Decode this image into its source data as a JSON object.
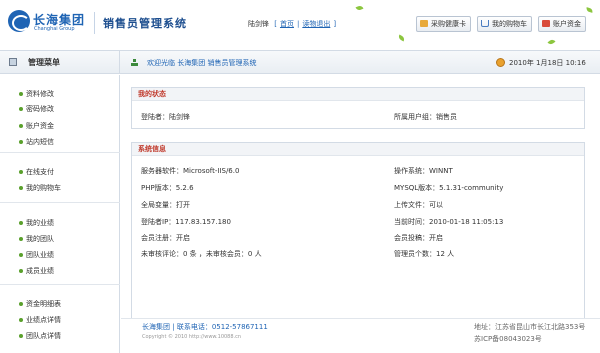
{
  "header": {
    "logo_cn": "长海集团",
    "logo_en": "Changhai Group",
    "system_title": "销售员管理系统",
    "user_name": "陆剑锋",
    "home_link": "首页",
    "logout_link": "读物退出",
    "buttons": [
      {
        "label": "采购健康卡",
        "icon": "card-icon"
      },
      {
        "label": "我的购物车",
        "icon": "cart-icon"
      },
      {
        "label": "账户资金",
        "icon": "fund-icon"
      }
    ]
  },
  "subbar": {
    "menu_title": "管理菜单",
    "welcome": "欢迎光临 长海集团 销售员管理系统",
    "datetime": "2010年 1月18日 10:16"
  },
  "sidebar": {
    "groups": [
      [
        "资料修改",
        "密码修改",
        "账户资金",
        "站内短信"
      ],
      [
        "在线支付",
        "我的购物车"
      ],
      [
        "我的业绩",
        "我的团队",
        "团队业绩",
        "成员业绩"
      ],
      [
        "资金明细表",
        "业绩点详情",
        "团队点详情"
      ]
    ]
  },
  "status_panel": {
    "title": "我的状态",
    "login_user": "登陆者：陆剑锋",
    "user_group": "所属用户组：销售员"
  },
  "system_panel": {
    "title": "系统信息",
    "rows": [
      [
        "服务器软件：Microsoft-IIS/6.0",
        "操作系统：WINNT"
      ],
      [
        "PHP版本：5.2.6",
        "MYSQL版本：5.1.31-community"
      ],
      [
        "全局变量：打开",
        "上传文件：可以"
      ],
      [
        "登陆者IP：117.83.157.180",
        "当前时间：2010-01-18 11:05:13"
      ],
      [
        "会员注册：开启",
        "会员投稿：开启"
      ],
      [
        "未审核评论：0 条 ，未审核会员：0 人",
        "管理员个数：12 人"
      ]
    ]
  },
  "footer": {
    "company": "长海集团",
    "hotline": "联系电话：0512-57867111",
    "copyright": "Copyright © 2010 http://www.10088.cn",
    "address": "地址：江苏省昆山市长江北路353号",
    "icp": "苏ICP备08043023号"
  },
  "colors": {
    "brand_blue": "#1f64b4",
    "title_red": "#c0392b",
    "nav_dot_green": "#5aa02c"
  }
}
